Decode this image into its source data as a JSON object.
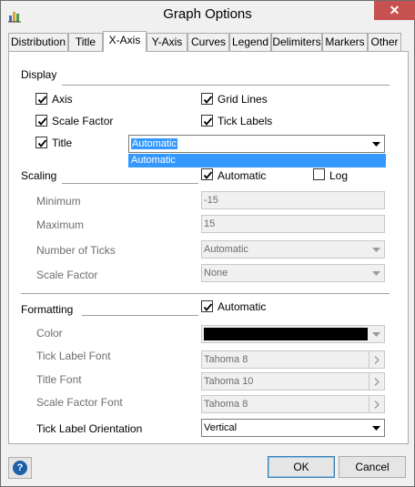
{
  "window": {
    "title": "Graph Options",
    "close_glyph": "✕"
  },
  "tabs": [
    {
      "label": "Distribution"
    },
    {
      "label": "Title"
    },
    {
      "label": "X-Axis"
    },
    {
      "label": "Y-Axis"
    },
    {
      "label": "Curves"
    },
    {
      "label": "Legend"
    },
    {
      "label": "Delimiters"
    },
    {
      "label": "Markers"
    },
    {
      "label": "Other"
    }
  ],
  "active_tab": "X-Axis",
  "display": {
    "section_label": "Display",
    "axis": {
      "label": "Axis",
      "checked": true
    },
    "grid_lines": {
      "label": "Grid Lines",
      "checked": true
    },
    "scale_factor": {
      "label": "Scale Factor",
      "checked": true
    },
    "tick_labels": {
      "label": "Tick Labels",
      "checked": true
    },
    "title": {
      "label": "Title",
      "checked": true
    },
    "title_select": {
      "value": "Automatic",
      "dropdown_option": "Automatic"
    }
  },
  "scaling": {
    "section_label": "Scaling",
    "automatic": {
      "label": "Automatic",
      "checked": true
    },
    "log": {
      "label": "Log",
      "checked": false
    },
    "minimum": {
      "label": "Minimum",
      "value": "-15"
    },
    "maximum": {
      "label": "Maximum",
      "value": "15"
    },
    "number_of_ticks": {
      "label": "Number of Ticks",
      "value": "Automatic"
    },
    "scale_factor": {
      "label": "Scale Factor",
      "value": "None"
    }
  },
  "formatting": {
    "section_label": "Formatting",
    "automatic": {
      "label": "Automatic",
      "checked": true
    },
    "color": {
      "label": "Color",
      "value": "#000000"
    },
    "tick_label_font": {
      "label": "Tick Label Font",
      "value": "Tahoma 8"
    },
    "title_font": {
      "label": "Title Font",
      "value": "Tahoma 10"
    },
    "scale_factor_font": {
      "label": "Scale Factor Font",
      "value": "Tahoma 8"
    },
    "tick_label_orientation": {
      "label": "Tick Label Orientation",
      "value": "Vertical"
    }
  },
  "footer": {
    "help_glyph": "?",
    "ok_label": "OK",
    "cancel_label": "Cancel"
  },
  "colors": {
    "selection": "#3399ff",
    "close": "#c75050"
  }
}
